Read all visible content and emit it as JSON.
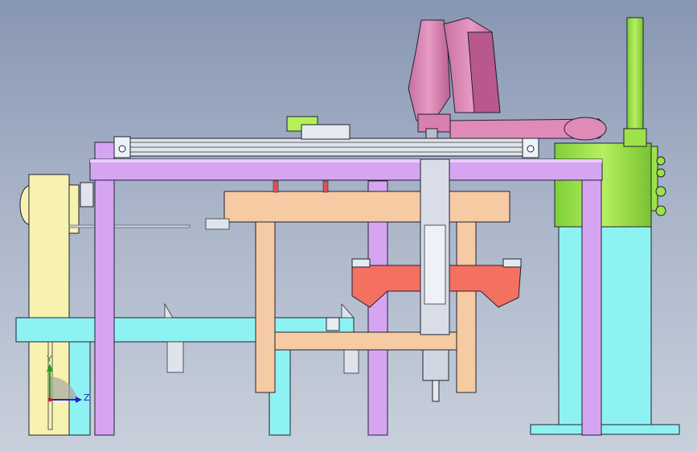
{
  "viewport": {
    "background_top": "#8796b2",
    "background_bottom": "#c9d0dc"
  },
  "colors": {
    "frame_purple": "#d6a5f2",
    "conveyor_cyan": "#8ff2f2",
    "wood_beige": "#f6caa2",
    "gripper_red": "#f47060",
    "robot_pink": "#e08ab8",
    "cabinet_green": "#9ee24a",
    "pole_green": "#8fd64a",
    "post_yellow": "#f8f2b0",
    "actuator_grey": "#d8dde8",
    "edge_dark": "#222233"
  },
  "triad": {
    "z_label": "Z",
    "y_label": "Y",
    "icon": "coordinate-triad-icon"
  }
}
